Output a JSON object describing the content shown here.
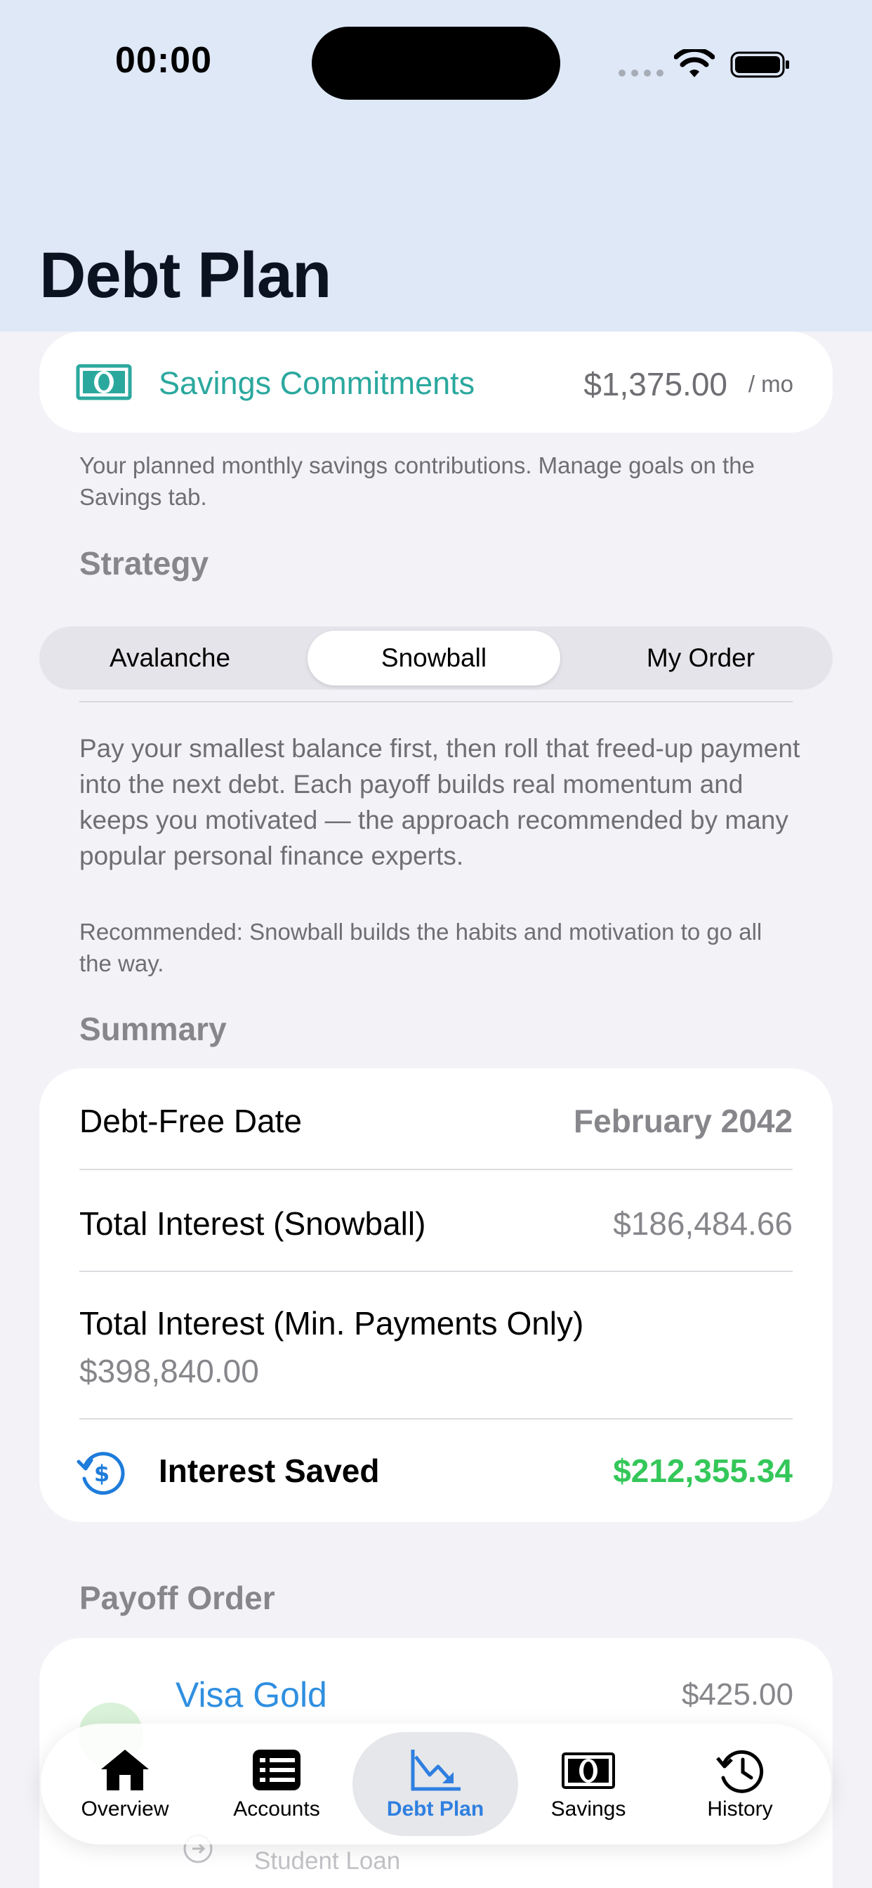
{
  "status_bar": {
    "time": "00:00"
  },
  "page": {
    "title": "Debt Plan"
  },
  "savings": {
    "label": "Savings Commitments",
    "amount": "$1,375.00",
    "per": "/ mo",
    "footnote": "Your planned monthly savings contributions. Manage goals on the Savings tab.",
    "icon": "banknote-icon"
  },
  "strategy": {
    "header": "Strategy",
    "options": [
      "Avalanche",
      "Snowball",
      "My Order"
    ],
    "selected": "Snowball",
    "description": "Pay your smallest balance first, then roll that freed-up payment into the next debt. Each payoff builds real momentum and keeps you motivated — the approach recommended by many popular personal finance experts.",
    "recommendation": "Recommended: Snowball builds the habits and motivation to go all the way."
  },
  "summary": {
    "header": "Summary",
    "debt_free_label": "Debt-Free Date",
    "debt_free_value": "February 2042",
    "interest_snowball_label": "Total Interest (Snowball)",
    "interest_snowball_value": "$186,484.66",
    "interest_min_label": "Total Interest (Min. Payments Only)",
    "interest_min_value": "$398,840.00",
    "saved_label": "Interest Saved",
    "saved_value": "$212,355.34",
    "saved_color": "#34C759"
  },
  "payoff": {
    "header": "Payoff Order",
    "first_name": "Visa Gold",
    "first_amount": "$425.00",
    "next_name": "Student Loan"
  },
  "tabbar": {
    "items": [
      {
        "label": "Overview",
        "icon": "house-icon"
      },
      {
        "label": "Accounts",
        "icon": "list-icon"
      },
      {
        "label": "Debt Plan",
        "icon": "chart-down-icon"
      },
      {
        "label": "Savings",
        "icon": "banknote-icon"
      },
      {
        "label": "History",
        "icon": "clock-history-icon"
      }
    ],
    "active": "Debt Plan",
    "accent": "#2F7FE0"
  }
}
